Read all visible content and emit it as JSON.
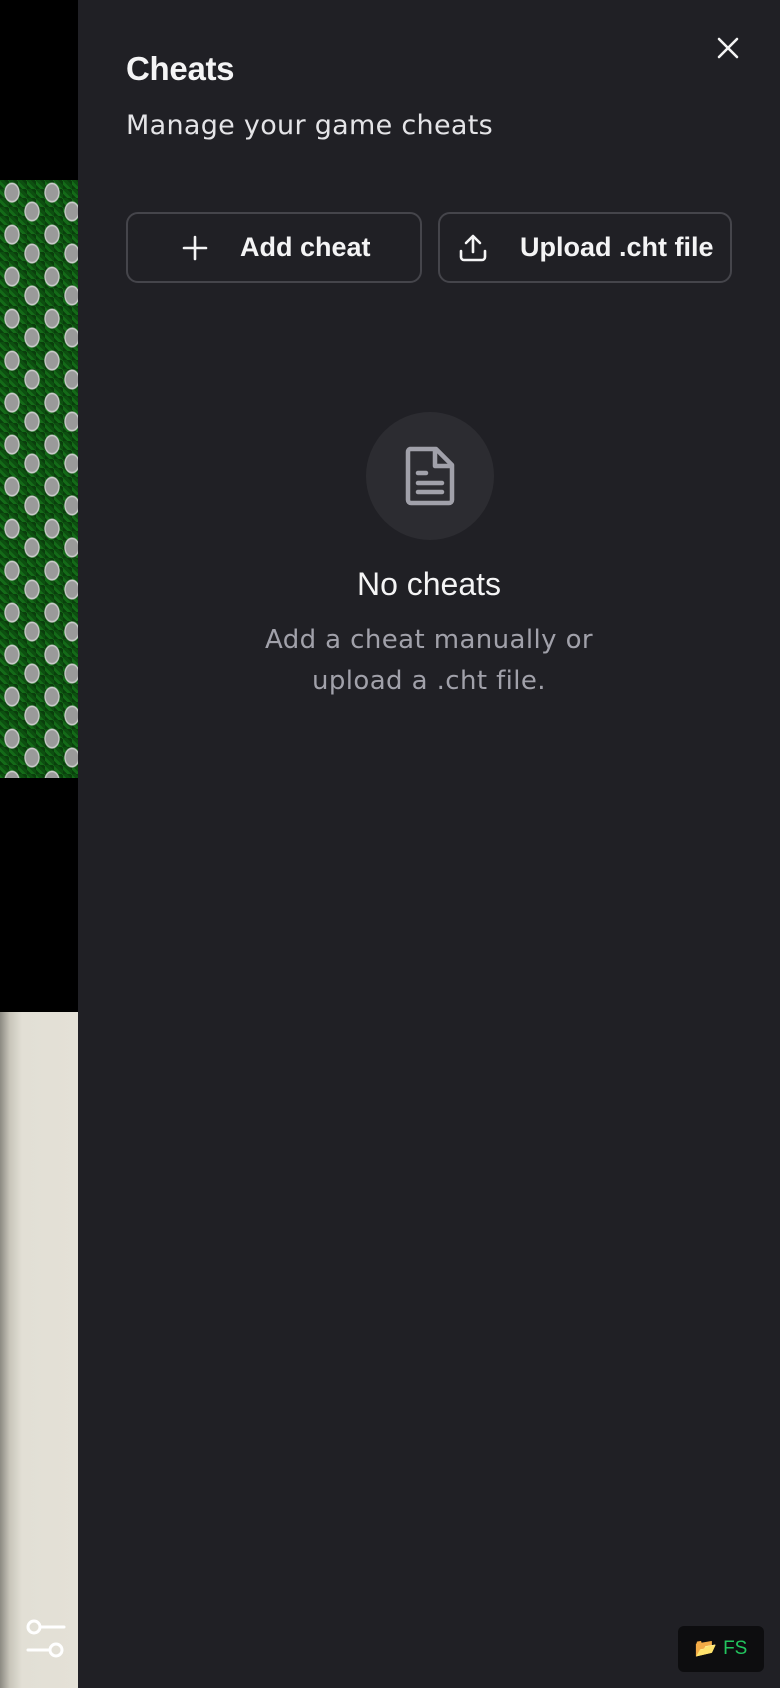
{
  "panel": {
    "title": "Cheats",
    "subtitle": "Manage your game cheats",
    "close_icon": "close-icon"
  },
  "actions": {
    "add_label": "Add cheat",
    "add_icon": "plus-icon",
    "upload_label": "Upload .cht file",
    "upload_icon": "upload-icon"
  },
  "empty_state": {
    "icon": "document-icon",
    "title": "No cheats",
    "description_line1": "Add a cheat manually or",
    "description_line2": "upload a .cht file."
  },
  "overlay": {
    "settings_icon": "settings-sliders-icon",
    "fs_icon": "folder-icon",
    "fs_label": "FS"
  },
  "colors": {
    "panel_bg": "#202025",
    "border": "#45454b",
    "text_primary": "#f4f4f5",
    "text_muted": "#a1a1aa",
    "fs_accent": "#22c55e"
  }
}
